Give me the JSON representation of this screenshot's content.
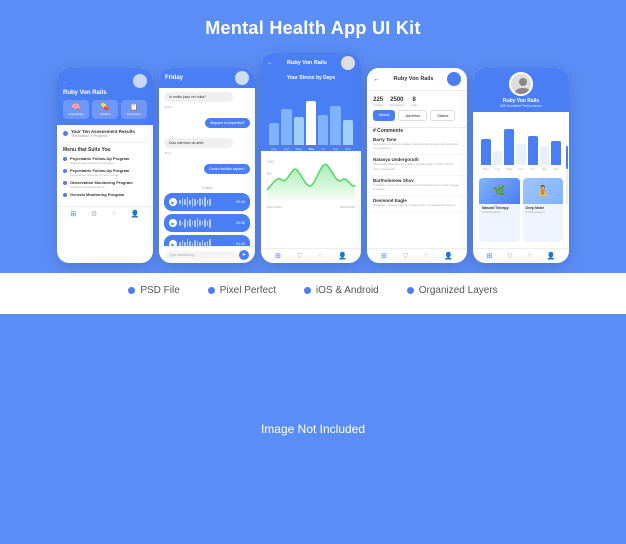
{
  "page": {
    "title": "Mental Health App UI Kit",
    "background_color": "#5b8df6"
  },
  "phones": {
    "phone1": {
      "username": "Ruby Von Rails",
      "cards": [
        {
          "icon": "🧠",
          "label": "Psychology"
        },
        {
          "icon": "📋",
          "label": "Solution"
        },
        {
          "icon": "📄",
          "label": "Document"
        }
      ],
      "transaction": {
        "title": "Your Ten Assessment Results",
        "subtitle": "Transaction in Progress"
      },
      "menu_title": "Menu that Suits You",
      "menu_items": [
        {
          "title": "Psychiatric Follow-Up Program",
          "sub": "Pellentesque tincidunt fermentum"
        },
        {
          "title": "Psychiatric Follow-Up Program",
          "sub": "Sed pretium molestie ac nunc rutrum"
        },
        {
          "title": "Observation Monitoring Program",
          "sub": "Curabitur volutpat amet at"
        },
        {
          "title": "General Monitoring Program",
          "sub": ""
        }
      ]
    },
    "phone2": {
      "day": "Friday",
      "messages": [
        {
          "text": "In mollis justo vel nulla?",
          "side": "left",
          "time": "09:31"
        },
        {
          "text": "Aliquam eu imperdiet?",
          "side": "right",
          "time": "09:31"
        },
        {
          "text": "Duis interdum do artet",
          "side": "left",
          "time": "09:11"
        },
        {
          "text": "Donec facilisis sapien?",
          "side": "right",
          "time": "02:18"
        }
      ],
      "today_label": "Today",
      "audio_duration": "02:44",
      "input_placeholder": "Type something..."
    },
    "phone3": {
      "username": "Ruby Von Rails",
      "chart_title": "Your Stress by Days",
      "days": [
        "Mon",
        "Tue",
        "Wed",
        "Thu",
        "Fri",
        "Sat",
        "Sun"
      ],
      "bars": [
        40,
        65,
        50,
        80,
        55,
        70,
        45
      ]
    },
    "phone4": {
      "username": "Ruby Von Rails",
      "stats": [
        {
          "num": "225",
          "label": "Treated"
        },
        {
          "num": "2500",
          "label": "Discharged"
        },
        {
          "num": "8",
          "label": "Years"
        }
      ],
      "buttons": [
        "About",
        "Address",
        "Status"
      ],
      "comments_title": "# Comments",
      "comments": [
        {
          "name": "Barry Tone",
          "text": "Sed pulvinar libero ex aliquet vehicula. Sed congue aliquet ipsum, non interdum."
        },
        {
          "name": "Natasya Undergoruth",
          "text": "Maecenas placerat nisi ut libero gravida auctor. Nulla rhoncus. Nunc consequat."
        },
        {
          "name": "Bartholomew Shov",
          "text": "Curabitur metus est tempus a just tincidunt semper vartur. Integer in augue eu."
        },
        {
          "name": "Desmond Eagle",
          "text": "Curabitur molestie egestas metus futur lorem consequat lorem @rubyvon."
        }
      ]
    },
    "phone5": {
      "name": "Ruby Von Rails",
      "role": "585 Excellent Performance",
      "days": [
        "Mon",
        "Tue",
        "Wed",
        "Thu",
        "Fri",
        "Sat",
        "Sun"
      ],
      "bars": [
        55,
        30,
        75,
        45,
        60,
        40,
        50
      ],
      "cards": [
        {
          "title": "Natural Therapy",
          "sub": "6 Participation"
        },
        {
          "title": "Deep Mode",
          "sub": "8 Participation"
        }
      ]
    }
  },
  "features": [
    {
      "label": "PSD File",
      "color": "#4a7ef5"
    },
    {
      "label": "Pixel Perfect",
      "color": "#4a7ef5"
    },
    {
      "label": "iOS & Android",
      "color": "#4a7ef5"
    },
    {
      "label": "Organized Layers",
      "color": "#4a7ef5"
    }
  ],
  "bottom_bar": {
    "text": "Image Not Included"
  }
}
